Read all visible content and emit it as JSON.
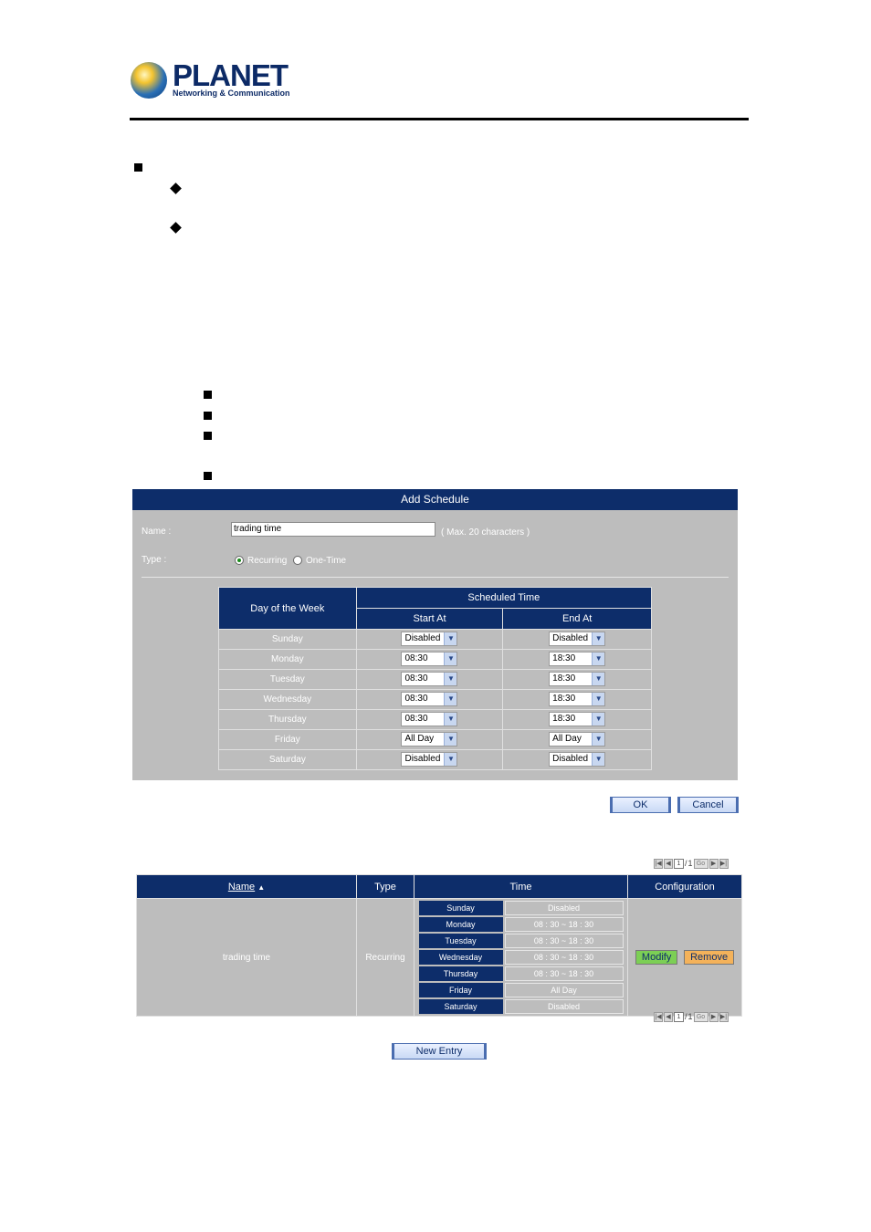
{
  "brand": {
    "name": "PLANET",
    "tagline": "Networking & Communication"
  },
  "add_schedule": {
    "title": "Add Schedule",
    "name_label": "Name :",
    "name_value": "trading time",
    "name_hint": "( Max. 20 characters )",
    "type_label": "Type :",
    "type_options": [
      "Recurring",
      "One-Time"
    ],
    "type_selected": "Recurring",
    "headers": {
      "day": "Day of the Week",
      "scheduled": "Scheduled Time",
      "start": "Start At",
      "end": "End At"
    },
    "rows": [
      {
        "day": "Sunday",
        "start": "Disabled",
        "end": "Disabled"
      },
      {
        "day": "Monday",
        "start": "08:30",
        "end": "18:30"
      },
      {
        "day": "Tuesday",
        "start": "08:30",
        "end": "18:30"
      },
      {
        "day": "Wednesday",
        "start": "08:30",
        "end": "18:30"
      },
      {
        "day": "Thursday",
        "start": "08:30",
        "end": "18:30"
      },
      {
        "day": "Friday",
        "start": "All Day",
        "end": "All Day"
      },
      {
        "day": "Saturday",
        "start": "Disabled",
        "end": "Disabled"
      }
    ],
    "ok_label": "OK",
    "cancel_label": "Cancel"
  },
  "pager": {
    "current": "1",
    "sep": "/",
    "total": "1",
    "go": "Go"
  },
  "list": {
    "headers": {
      "name": "Name",
      "type": "Type",
      "time": "Time",
      "config": "Configuration"
    },
    "entry": {
      "name": "trading time",
      "type": "Recurring",
      "times": [
        {
          "day": "Sunday",
          "time": "Disabled"
        },
        {
          "day": "Monday",
          "time": "08 : 30 ~ 18 : 30"
        },
        {
          "day": "Tuesday",
          "time": "08 : 30 ~ 18 : 30"
        },
        {
          "day": "Wednesday",
          "time": "08 : 30 ~ 18 : 30"
        },
        {
          "day": "Thursday",
          "time": "08 : 30 ~ 18 : 30"
        },
        {
          "day": "Friday",
          "time": "All Day"
        },
        {
          "day": "Saturday",
          "time": "Disabled"
        }
      ],
      "modify_label": "Modify",
      "remove_label": "Remove"
    }
  },
  "new_entry_label": "New Entry",
  "colors": {
    "header_navy": "#0d2d6a",
    "panel_gray": "#bdbdbd",
    "modify_green": "#7ccf55",
    "remove_orange": "#f4b25a"
  }
}
